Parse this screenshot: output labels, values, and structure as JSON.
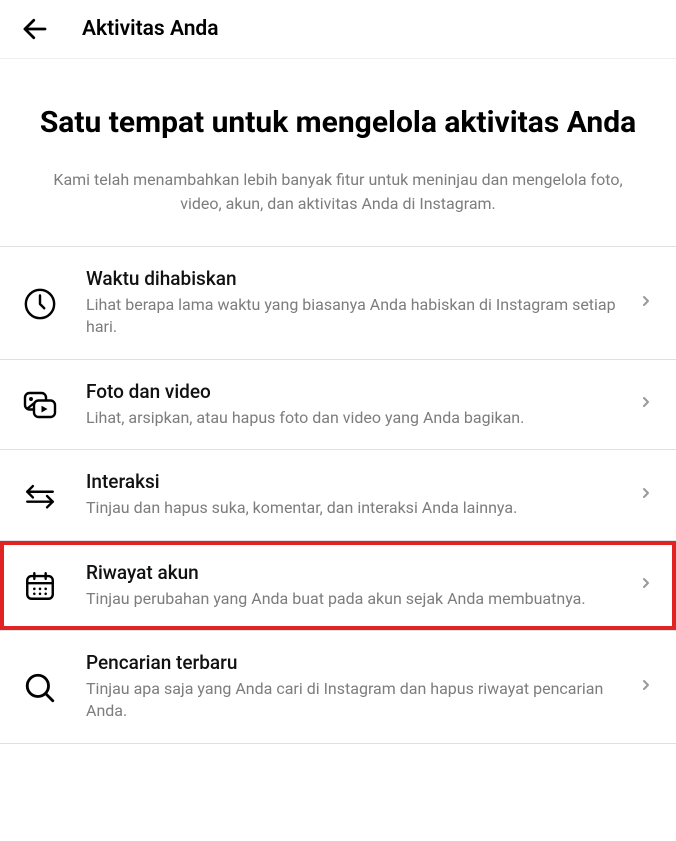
{
  "header": {
    "title": "Aktivitas Anda"
  },
  "intro": {
    "title": "Satu tempat untuk mengelola aktivitas Anda",
    "desc": "Kami telah menambahkan lebih banyak fitur untuk meninjau dan mengelola foto, video, akun, dan aktivitas Anda di Instagram."
  },
  "items": [
    {
      "title": "Waktu dihabiskan",
      "desc": "Lihat berapa lama waktu yang biasanya Anda habiskan di Instagram setiap hari."
    },
    {
      "title": "Foto dan video",
      "desc": "Lihat, arsipkan, atau hapus foto dan video yang Anda bagikan."
    },
    {
      "title": "Interaksi",
      "desc": "Tinjau dan hapus suka, komentar, dan interaksi Anda lainnya."
    },
    {
      "title": "Riwayat akun",
      "desc": "Tinjau perubahan yang Anda buat pada akun sejak Anda membuatnya."
    },
    {
      "title": "Pencarian terbaru",
      "desc": "Tinjau apa saja yang Anda cari di Instagram dan hapus riwayat pencarian Anda."
    }
  ]
}
